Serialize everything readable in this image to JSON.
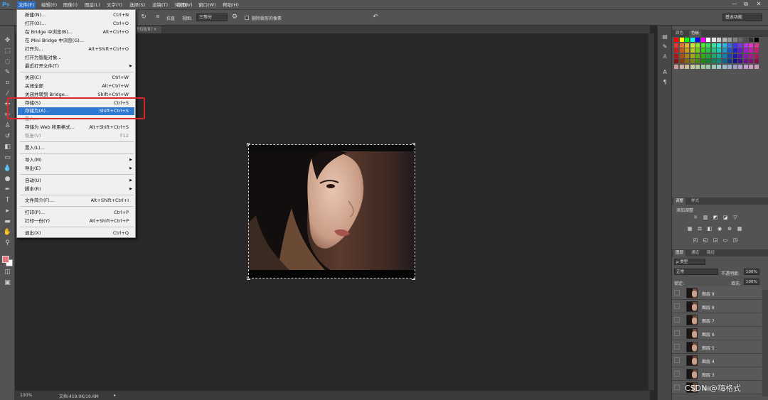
{
  "app": {
    "logo": "Ps"
  },
  "menubar": {
    "items": [
      {
        "label": "文件(F)",
        "active": true
      },
      {
        "label": "编辑(E)"
      },
      {
        "label": "图像(I)"
      },
      {
        "label": "图层(L)"
      },
      {
        "label": "文字(Y)"
      },
      {
        "label": "选择(S)"
      },
      {
        "label": "滤镜(T)"
      },
      {
        "label": "3D(D)"
      },
      {
        "label": "视图(V)"
      },
      {
        "label": "窗口(W)"
      },
      {
        "label": "帮助(H)"
      }
    ],
    "window_controls": [
      "—",
      "⧉",
      "✕"
    ]
  },
  "options_bar": {
    "straighten": "拉直",
    "view_label": "视图:",
    "view_value": "三等分",
    "delete_cropped": "删除裁剪的像素",
    "workspace": "基本功能"
  },
  "document_tab": {
    "label": "层 1, RGB/8) ×"
  },
  "file_menu": {
    "items": [
      {
        "label": "新建(N)...",
        "shortcut": "Ctrl+N"
      },
      {
        "label": "打开(O)...",
        "shortcut": "Ctrl+O"
      },
      {
        "label": "在 Bridge 中浏览(B)...",
        "shortcut": "Alt+Ctrl+O"
      },
      {
        "label": "在 Mini Bridge 中浏览(G)...",
        "shortcut": ""
      },
      {
        "label": "打开为...",
        "shortcut": "Alt+Shift+Ctrl+O"
      },
      {
        "label": "打开为智能对象...",
        "shortcut": ""
      },
      {
        "label": "最近打开文件(T)",
        "shortcut": "",
        "submenu": true
      },
      {
        "label": "关闭(C)",
        "shortcut": "Ctrl+W"
      },
      {
        "label": "关闭全部",
        "shortcut": "Alt+Ctrl+W"
      },
      {
        "label": "关闭并转到 Bridge...",
        "shortcut": "Shift+Ctrl+W"
      },
      {
        "label": "存储(S)",
        "shortcut": "Ctrl+S"
      },
      {
        "label": "存储为(A)...",
        "shortcut": "Shift+Ctrl+S",
        "highlighted": true
      },
      {
        "label": "签入...",
        "shortcut": ""
      },
      {
        "label": "存储为 Web 所用格式...",
        "shortcut": "Alt+Shift+Ctrl+S"
      },
      {
        "label": "恢复(V)",
        "shortcut": "F12",
        "disabled": true
      },
      {
        "label": "置入(L)...",
        "shortcut": ""
      },
      {
        "label": "导入(M)",
        "shortcut": "",
        "submenu": true
      },
      {
        "label": "导出(E)",
        "shortcut": "",
        "submenu": true
      },
      {
        "label": "自动(U)",
        "shortcut": "",
        "submenu": true
      },
      {
        "label": "脚本(R)",
        "shortcut": "",
        "submenu": true
      },
      {
        "label": "文件简介(F)...",
        "shortcut": "Alt+Shift+Ctrl+I"
      },
      {
        "label": "打印(P)...",
        "shortcut": "Ctrl+P"
      },
      {
        "label": "打印一份(Y)",
        "shortcut": "Alt+Shift+Ctrl+P"
      },
      {
        "label": "退出(X)",
        "shortcut": "Ctrl+Q"
      }
    ]
  },
  "status_bar": {
    "zoom": "100%",
    "doc_size": "文档:419.0K/19.6M"
  },
  "panels": {
    "swatch_tabs": [
      "颜色",
      "色板"
    ],
    "adjust_tabs": [
      "调整",
      "样式"
    ],
    "adjust_title": "添加调整",
    "layers_tabs": [
      "图层",
      "通道",
      "路径"
    ],
    "filter_kind": "ρ 类型",
    "blend_mode": "正常",
    "opacity_label": "不透明度:",
    "opacity_value": "100%",
    "lock_label": "锁定:",
    "fill_label": "填充:",
    "fill_value": "100%",
    "layers": [
      "图层 9",
      "图层 8",
      "图层 7",
      "图层 6",
      "图层 5",
      "图层 4",
      "图层 3",
      "图层 2"
    ]
  },
  "watermark": "CSDN @嗨格式",
  "colors": {
    "accent": "#2f79d2",
    "highlight_box": "#d9262b",
    "foreground_swatch": "#e0797e"
  }
}
